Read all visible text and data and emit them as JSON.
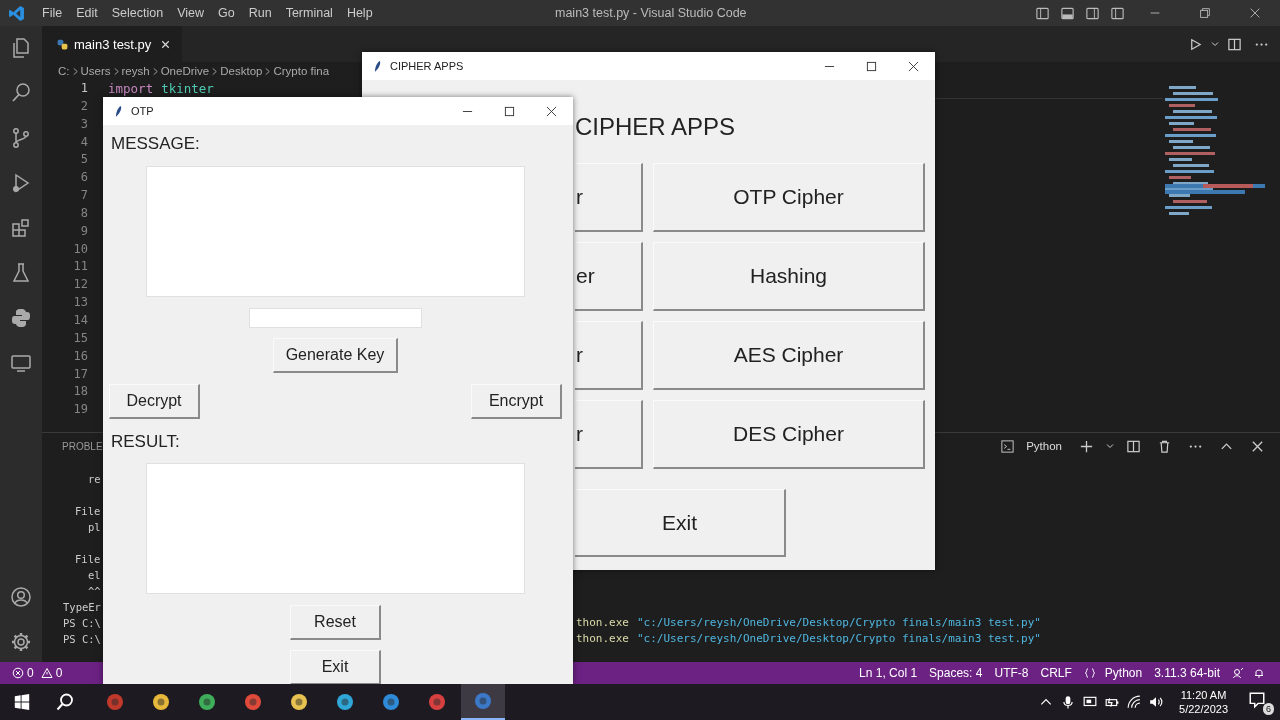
{
  "vscode": {
    "menu": [
      "File",
      "Edit",
      "Selection",
      "View",
      "Go",
      "Run",
      "Terminal",
      "Help"
    ],
    "title": "main3 test.py - Visual Studio Code",
    "tab": {
      "label": "main3 test.py",
      "selected": true
    },
    "breadcrumb": [
      "C:",
      "Users",
      "reysh",
      "OneDrive",
      "Desktop",
      "Crypto fina"
    ],
    "line_numbers": [
      {
        "text": "1",
        "active": true
      },
      {
        "text": "2",
        "active": false
      },
      {
        "text": "3",
        "active": false
      },
      {
        "text": "4",
        "active": false
      },
      {
        "text": "5",
        "active": false
      },
      {
        "text": "6",
        "active": false
      },
      {
        "text": "7",
        "active": false
      },
      {
        "text": "8",
        "active": false
      },
      {
        "text": "9",
        "active": false
      },
      {
        "text": "10",
        "active": false
      },
      {
        "text": "11",
        "active": false
      },
      {
        "text": "12",
        "active": false
      },
      {
        "text": "13",
        "active": false
      },
      {
        "text": "14",
        "active": false
      },
      {
        "text": "15",
        "active": false
      },
      {
        "text": "16",
        "active": false
      },
      {
        "text": "17",
        "active": false
      },
      {
        "text": "18",
        "active": false
      },
      {
        "text": "19",
        "active": false
      }
    ],
    "code_lines": [
      {
        "keyword": "import",
        "name": "tkinter"
      }
    ],
    "panel": {
      "tab": "PROBLE",
      "terminal": "Python",
      "lines": [
        {
          "kind": "deep",
          "text": "re"
        },
        {
          "kind": "blank"
        },
        {
          "kind": "frame",
          "text": "File"
        },
        {
          "kind": "deep",
          "text": "pl"
        },
        {
          "kind": "blank"
        },
        {
          "kind": "frame",
          "text": "File"
        },
        {
          "kind": "deep",
          "text": "el"
        },
        {
          "kind": "deep",
          "text": "^^"
        },
        {
          "kind": "top",
          "text": "TypeEr"
        },
        {
          "kind": "top",
          "text": "PS C:\\",
          "command": "thon.exe",
          "argument": "\"c:/Users/reysh/OneDrive/Desktop/Crypto finals/main3 test.py\""
        },
        {
          "kind": "top",
          "text": "PS C:\\",
          "command": "thon.exe",
          "argument": "\"c:/Users/reysh/OneDrive/Desktop/Crypto finals/main3 test.py\""
        }
      ]
    },
    "status_bar": {
      "errors": "0",
      "warnings": "0",
      "items": [
        {
          "kind": "text",
          "text": "Ln 1, Col 1"
        },
        {
          "kind": "text",
          "text": "Spaces: 4"
        },
        {
          "kind": "text",
          "text": "UTF-8"
        },
        {
          "kind": "text",
          "text": "CRLF"
        },
        {
          "kind": "language",
          "text": "Python"
        },
        {
          "kind": "text",
          "text": "3.11.3 64-bit"
        }
      ]
    }
  },
  "cipher_window": {
    "title": "CIPHER APPS",
    "heading": "CIPHER APPS",
    "left_buttons": [
      "r",
      "er",
      "r",
      "r"
    ],
    "right_buttons": [
      "OTP Cipher",
      "Hashing",
      "AES Cipher",
      "DES Cipher"
    ],
    "exit": "Exit"
  },
  "otp_window": {
    "title": "OTP",
    "message_label": "MESSAGE:",
    "generate": "Generate Key",
    "decrypt": "Decrypt",
    "encrypt": "Encrypt",
    "result_label": "RESULT:",
    "reset": "Reset",
    "exit": "Exit"
  },
  "taskbar": {
    "apps": [
      {
        "selected": false
      },
      {
        "selected": false
      },
      {
        "selected": false
      },
      {
        "selected": false
      },
      {
        "selected": false
      },
      {
        "selected": false
      },
      {
        "selected": false
      },
      {
        "selected": false
      },
      {
        "selected": true
      }
    ],
    "time": "11:20 AM",
    "date": "5/22/2023",
    "notifications": "6"
  }
}
